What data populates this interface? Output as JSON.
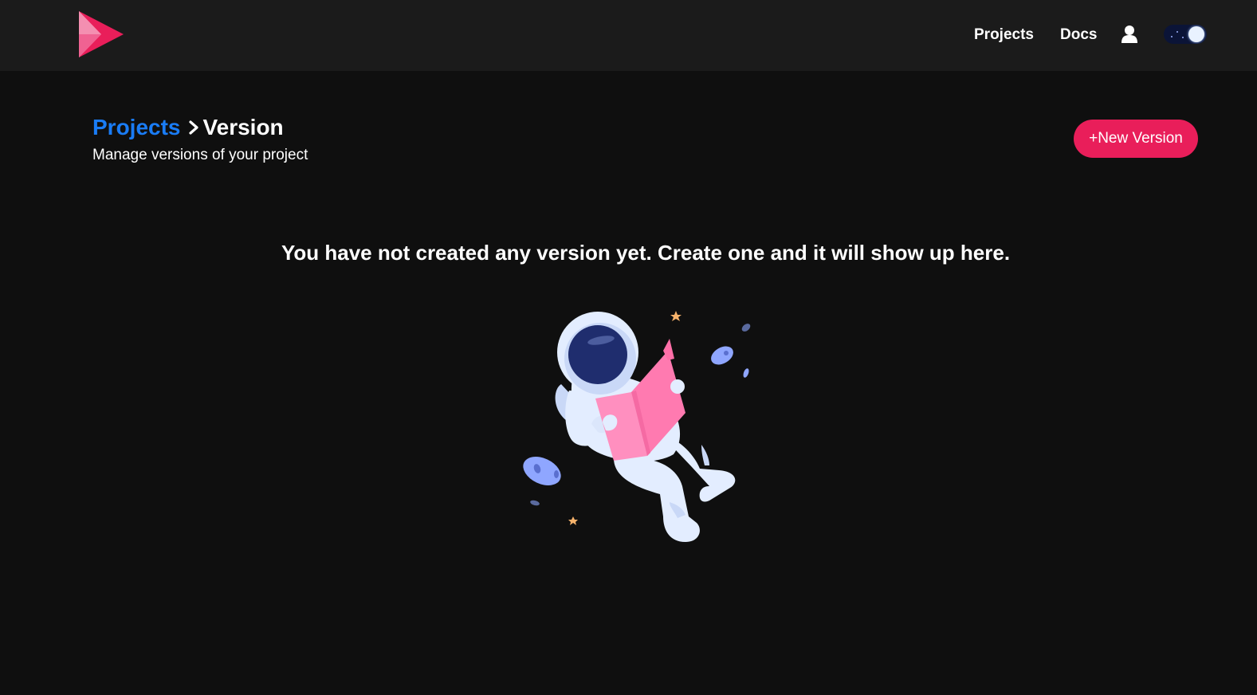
{
  "navbar": {
    "logo": "play-triangle-logo",
    "links": [
      {
        "label": "Projects"
      },
      {
        "label": "Docs"
      }
    ],
    "user_icon": "user-icon",
    "theme_toggle": {
      "state": "dark"
    }
  },
  "header": {
    "breadcrumb": {
      "parent": "Projects",
      "separator_icon": "chevron-right-icon",
      "current": "Version"
    },
    "subtitle": "Manage versions of your project",
    "new_version_button": "+New Version"
  },
  "empty_state": {
    "message": "You have not created any version yet. Create one and it will show up here.",
    "illustration": "astronaut-reading-illustration"
  },
  "colors": {
    "background": "#0f0f0f",
    "navbar": "#1b1b1b",
    "accent": "#e91e5a",
    "link": "#1a7cf5"
  }
}
